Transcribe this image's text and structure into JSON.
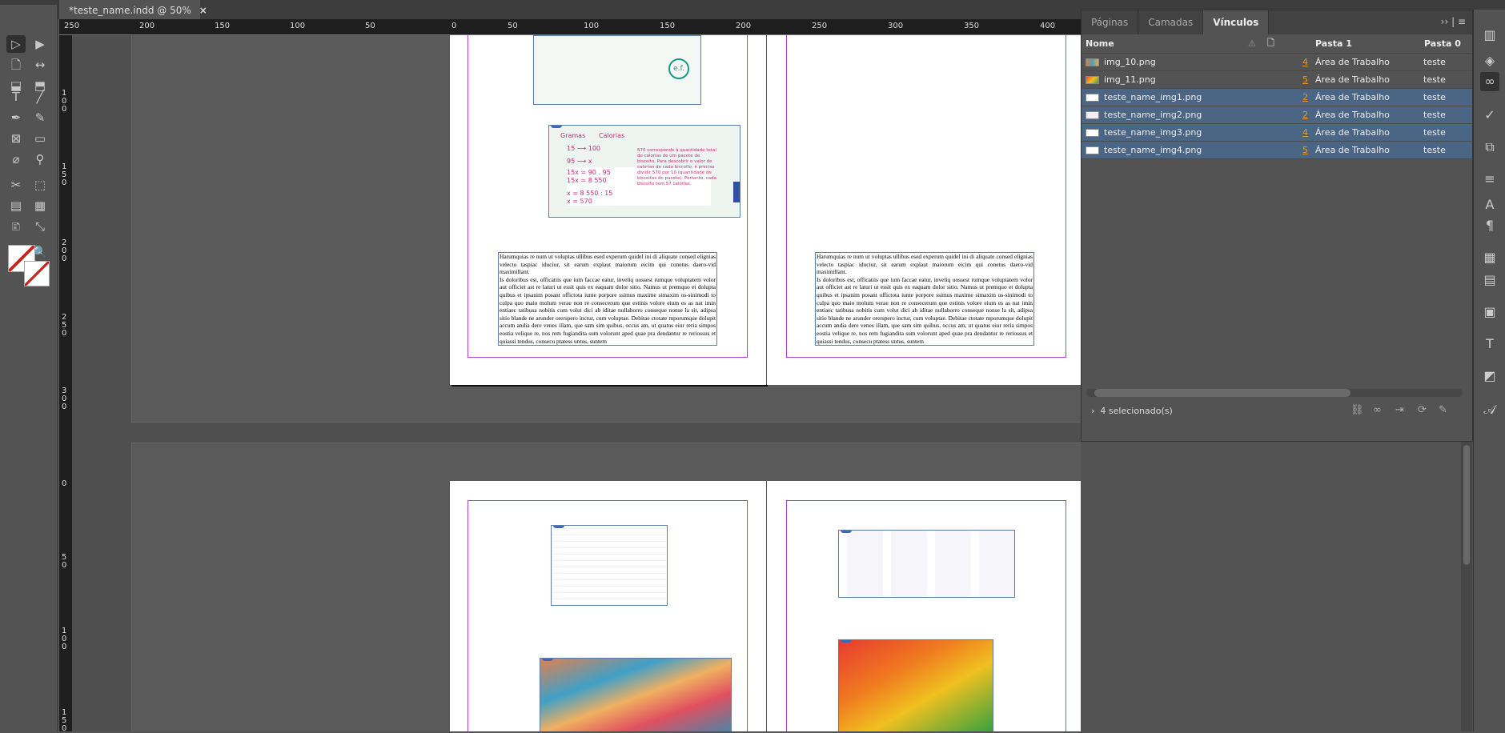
{
  "document_tab": {
    "title": "*teste_name.indd @ 50%",
    "close": "×"
  },
  "ruler": {
    "top_labels": [
      "250",
      "200",
      "150",
      "100",
      "50",
      "0",
      "50",
      "100",
      "150",
      "200",
      "250",
      "300",
      "350",
      "400"
    ],
    "left_labels": [
      "100",
      "150",
      "200",
      "250",
      "300",
      "0",
      "50",
      "100",
      "150"
    ]
  },
  "tools": [
    {
      "name": "selection-tool",
      "glyph": "▷"
    },
    {
      "name": "direct-selection-tool",
      "glyph": "▶"
    },
    {
      "name": "page-tool",
      "glyph": "🗋"
    },
    {
      "name": "gap-tool",
      "glyph": "↔"
    },
    {
      "name": "content-collector-tool",
      "glyph": "⬓"
    },
    {
      "name": "content-placer-tool",
      "glyph": "⬒"
    },
    {
      "name": "type-tool",
      "glyph": "T"
    },
    {
      "name": "line-tool",
      "glyph": "╱"
    },
    {
      "name": "pen-tool",
      "glyph": "✒"
    },
    {
      "name": "pencil-tool",
      "glyph": "✎"
    },
    {
      "name": "rectangle-frame-tool",
      "glyph": "⊠"
    },
    {
      "name": "rectangle-tool",
      "glyph": "▭"
    },
    {
      "name": "scissors-path-tool",
      "glyph": "⌀"
    },
    {
      "name": "pin-tool",
      "glyph": "⚲"
    },
    {
      "name": "scissors-tool",
      "glyph": "✂"
    },
    {
      "name": "free-transform-tool",
      "glyph": "⬚"
    },
    {
      "name": "gradient-swatch-tool",
      "glyph": "▤"
    },
    {
      "name": "gradient-feather-tool",
      "glyph": "▦"
    },
    {
      "name": "note-tool",
      "glyph": "🗈"
    },
    {
      "name": "eyedropper-tool",
      "glyph": "⤡"
    },
    {
      "name": "hand-tool",
      "glyph": "✋"
    },
    {
      "name": "zoom-tool",
      "glyph": "🔍"
    }
  ],
  "text_frame": {
    "body": "Harumquias re num ut voluptas ullibus esed experum quidel ini di aliquate consed elignias velecto taspiac iduciur, sit earum explaut maiorum eicim qui conetus daero-vid maximillant.\nIs doloribus est, officatiis que ium faccae eatur, inveliq uossest rumque voluptatem volor aut officiet ast re laturi ut essit quis ex eaquam dolor sitio. Namus ut premquo et dolupta quibus et ipsanim posant offictota iunte porpore ssimus maxime simaxim os-sinimodi to culpa quo maio molum verae non re consecerum que estinis volore eium es as nat imin entiaec tatibusa nobitis cum volut dici ab iditae nullaborro conseque nonse la sit, adipsa sitio blande ne arunder orerspero inctur, cum voluptae. Debitae ctotate mporumque dolupit accum andia dere venes illam, que sam sim quibus, occus am, ut quatus eiur reria simpos eostia velique re, nos rem fugiandita sum volorunt aped quae pra dendantur re reriossus et quiassi tendus, consecu ptatess untus, suntem"
  },
  "calories_image": {
    "col1": "Gramas",
    "col2": "Calorias",
    "l1": "15  ⟶  100",
    "l2": "95  ⟶  x",
    "l3": "15x = 90 . 95",
    "l4": "15x = 8 550",
    "l5": "x = 8 550 : 15",
    "l6": "x = 570",
    "note": "570 corresponde à quantidade total de calorias de um pacote de biscoito. Para descobrir o valor de calorias de cada biscoito, é preciso dividir 570 por 10 (quantidade de biscoitos do pacote). Portanto, cada biscoito tem 57 calorias."
  },
  "panel": {
    "tabs": [
      "Páginas",
      "Camadas",
      "Vínculos"
    ],
    "active_tab": "Vínculos",
    "menu": "›› | ≡",
    "columns": {
      "name": "Nome",
      "pasta1": "Pasta 1",
      "pasta0": "Pasta 0"
    },
    "rows": [
      {
        "name": "img_10.png",
        "page": "4",
        "pasta1": "Área de Trabalho",
        "pasta0": "teste",
        "selected": false,
        "thumb": "linear-gradient(90deg,#e07a3a,#4aa0c0,#e0b040)"
      },
      {
        "name": "img_11.png",
        "page": "5",
        "pasta1": "Área de Trabalho",
        "pasta0": "teste",
        "selected": false,
        "thumb": "linear-gradient(135deg,#e84a2a,#f0c020,#40a040)"
      },
      {
        "name": "teste_name_img1.png",
        "page": "2",
        "pasta1": "Área de Trabalho",
        "pasta0": "teste",
        "selected": true,
        "thumb": "#ffffff"
      },
      {
        "name": "teste_name_img2.png",
        "page": "2",
        "pasta1": "Área de Trabalho",
        "pasta0": "teste",
        "selected": true,
        "thumb": "#f4eef4"
      },
      {
        "name": "teste_name_img3.png",
        "page": "4",
        "pasta1": "Área de Trabalho",
        "pasta0": "teste",
        "selected": true,
        "thumb": "#ffffff"
      },
      {
        "name": "teste_name_img4.png",
        "page": "5",
        "pasta1": "Área de Trabalho",
        "pasta0": "teste",
        "selected": true,
        "thumb": "#ffffff"
      }
    ],
    "status": "4 selecionado(s)"
  },
  "colors": {
    "selection": "#4b6585",
    "page_link": "#e8962a",
    "margin": "#b43fd8",
    "frame": "#5e7ca8"
  }
}
